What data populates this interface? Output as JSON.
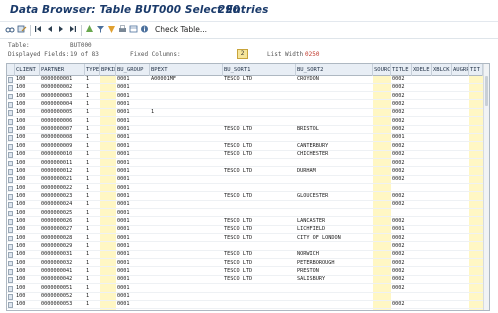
{
  "window": {
    "title": "Data Browser: Table BUT000 Select Entries",
    "count": "290"
  },
  "toolbar": {
    "icons": [
      "glasses-icon",
      "edit-icon",
      "first-page-icon",
      "prev-page-icon",
      "next-page-icon",
      "last-page-icon",
      "sort-asc-icon",
      "filter-icon",
      "sort-desc-icon",
      "print-icon",
      "layout-icon",
      "info-icon"
    ],
    "check_table_label": "Check Table..."
  },
  "info": {
    "table_label": "Table:",
    "table_value": "BUT000",
    "displayed_label": "Displayed Fields:",
    "displayed_value": "19 of 83",
    "fixed_label": "Fixed Columns:",
    "fixed_value": "2",
    "list_width_label": "List Width",
    "list_width_value": "0250"
  },
  "table": {
    "columns": [
      "CLIENT",
      "PARTNER",
      "TYPE",
      "BPKIND",
      "BU_GROUP",
      "BPEXT",
      "BU_SORT1",
      "BU_SORT2",
      "SOURCE",
      "TITLE",
      "XDELE",
      "XBLCK",
      "AUGRP",
      "TIT"
    ],
    "rows": [
      [
        "100",
        "0000000001",
        "1",
        "",
        "0001",
        "A00001MF",
        "TESCO LTD",
        "CROYDON",
        "",
        "0002",
        "",
        "",
        "",
        ""
      ],
      [
        "100",
        "0000000002",
        "1",
        "",
        "0001",
        "",
        "",
        "",
        "",
        "0002",
        "",
        "",
        "",
        ""
      ],
      [
        "100",
        "0000000003",
        "1",
        "",
        "0001",
        "",
        "",
        "",
        "",
        "0002",
        "",
        "",
        "",
        ""
      ],
      [
        "100",
        "0000000004",
        "1",
        "",
        "0001",
        "",
        "",
        "",
        "",
        "0002",
        "",
        "",
        "",
        ""
      ],
      [
        "100",
        "0000000005",
        "1",
        "",
        "0001",
        "1",
        "",
        "",
        "",
        "0002",
        "",
        "",
        "",
        ""
      ],
      [
        "100",
        "0000000006",
        "1",
        "",
        "0001",
        "",
        "",
        "",
        "",
        "0002",
        "",
        "",
        "",
        ""
      ],
      [
        "100",
        "0000000007",
        "1",
        "",
        "0001",
        "",
        "TESCO LTD",
        "BRISTOL",
        "",
        "0002",
        "",
        "",
        "",
        ""
      ],
      [
        "100",
        "0000000008",
        "1",
        "",
        "0001",
        "",
        "",
        "",
        "",
        "0001",
        "",
        "",
        "",
        ""
      ],
      [
        "100",
        "0000000009",
        "1",
        "",
        "0001",
        "",
        "TESCO LTD",
        "CANTERBURY",
        "",
        "0002",
        "",
        "",
        "",
        ""
      ],
      [
        "100",
        "0000000010",
        "1",
        "",
        "0001",
        "",
        "TESCO LTD",
        "CHICHESTER",
        "",
        "0002",
        "",
        "",
        "",
        ""
      ],
      [
        "100",
        "0000000011",
        "1",
        "",
        "0001",
        "",
        "",
        "",
        "",
        "0002",
        "",
        "",
        "",
        ""
      ],
      [
        "100",
        "0000000012",
        "1",
        "",
        "0001",
        "",
        "TESCO LTD",
        "DURHAM",
        "",
        "0002",
        "",
        "",
        "",
        ""
      ],
      [
        "100",
        "0000000021",
        "1",
        "",
        "0001",
        "",
        "",
        "",
        "",
        "0002",
        "",
        "",
        "",
        ""
      ],
      [
        "100",
        "0000000022",
        "1",
        "",
        "0001",
        "",
        "",
        "",
        "",
        "",
        "",
        "",
        "",
        ""
      ],
      [
        "100",
        "0000000023",
        "1",
        "",
        "0001",
        "",
        "TESCO LTD",
        "GLOUCESTER",
        "",
        "0002",
        "",
        "",
        "",
        ""
      ],
      [
        "100",
        "0000000024",
        "1",
        "",
        "0001",
        "",
        "",
        "",
        "",
        "0002",
        "",
        "",
        "",
        ""
      ],
      [
        "100",
        "0000000025",
        "1",
        "",
        "0001",
        "",
        "",
        "",
        "",
        "",
        "",
        "",
        "",
        ""
      ],
      [
        "100",
        "0000000026",
        "1",
        "",
        "0001",
        "",
        "TESCO LTD",
        "LANCASTER",
        "",
        "0002",
        "",
        "",
        "",
        ""
      ],
      [
        "100",
        "0000000027",
        "1",
        "",
        "0001",
        "",
        "TESCO LTD",
        "LICHFIELD",
        "",
        "0001",
        "",
        "",
        "",
        ""
      ],
      [
        "100",
        "0000000028",
        "1",
        "",
        "0001",
        "",
        "TESCO LTD",
        "CITY OF LONDON",
        "",
        "0002",
        "",
        "",
        "",
        ""
      ],
      [
        "100",
        "0000000029",
        "1",
        "",
        "0001",
        "",
        "",
        "",
        "",
        "0002",
        "",
        "",
        "",
        ""
      ],
      [
        "100",
        "0000000031",
        "1",
        "",
        "0001",
        "",
        "TESCO LTD",
        "NORWICH",
        "",
        "0002",
        "",
        "",
        "",
        ""
      ],
      [
        "100",
        "0000000032",
        "1",
        "",
        "0001",
        "",
        "TESCO LTD",
        "PETERBOROUGH",
        "",
        "0002",
        "",
        "",
        "",
        ""
      ],
      [
        "100",
        "0000000041",
        "1",
        "",
        "0001",
        "",
        "TESCO LTD",
        "PRESTON",
        "",
        "0002",
        "",
        "",
        "",
        ""
      ],
      [
        "100",
        "0000000042",
        "1",
        "",
        "0001",
        "",
        "TESCO LTD",
        "SALISBURY",
        "",
        "0002",
        "",
        "",
        "",
        ""
      ],
      [
        "100",
        "0000000051",
        "1",
        "",
        "0001",
        "",
        "",
        "",
        "",
        "0002",
        "",
        "",
        "",
        ""
      ],
      [
        "100",
        "0000000052",
        "1",
        "",
        "0001",
        "",
        "",
        "",
        "",
        "",
        "",
        "",
        "",
        ""
      ],
      [
        "100",
        "0000000053",
        "1",
        "",
        "0001",
        "",
        "",
        "",
        "",
        "0002",
        "",
        "",
        "",
        ""
      ]
    ]
  }
}
